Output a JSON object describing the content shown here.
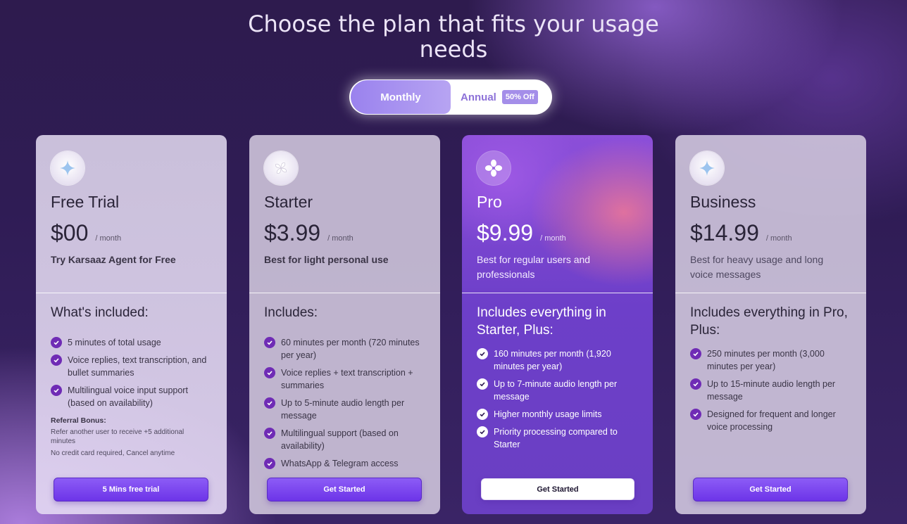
{
  "header": {
    "title": "Choose the plan that fits your usage needs"
  },
  "billing_toggle": {
    "monthly_label": "Monthly",
    "annual_label": "Annual",
    "annual_badge": "50% Off",
    "selected": "Monthly"
  },
  "plans": [
    {
      "icon": "sparkle-icon",
      "name": "Free Trial",
      "price": "$00",
      "period": "/ month",
      "description": "Try Karsaaz Agent for Free",
      "includes_title": "What's included:",
      "features": [
        "5 minutes of total usage",
        "Voice replies, text transcription, and bullet summaries",
        "Multilingual voice input support (based on availability)"
      ],
      "referral_heading": "Referral Bonus:",
      "referral_text": "Refer another user to receive +5 additional minutes",
      "note": "No credit card required, Cancel anytime",
      "button": "5 Mins free trial"
    },
    {
      "icon": "pinwheel-icon",
      "name": "Starter",
      "price": "$3.99",
      "period": "/ month",
      "description": "Best for light personal use",
      "includes_title": "Includes:",
      "features": [
        "60 minutes per month (720 minutes per year)",
        "Voice replies + text transcription + summaries",
        "Up to 5-minute audio length per message",
        "Multilingual support (based on availability)",
        "WhatsApp & Telegram access"
      ],
      "button": "Get Started"
    },
    {
      "icon": "flower-icon",
      "name": "Pro",
      "price": "$9.99",
      "period": "/ month",
      "description": "Best for regular users and professionals",
      "includes_title": "Includes everything in Starter, Plus:",
      "features": [
        "160 minutes per month (1,920 minutes per year)",
        "Up to 7-minute audio length per message",
        "Higher monthly usage limits",
        "Priority processing compared to Starter"
      ],
      "button": "Get Started"
    },
    {
      "icon": "sparkle-icon",
      "name": "Business",
      "price": "$14.99",
      "period": "/ month",
      "description": "Best for heavy usage and long voice messages",
      "includes_title": "Includes everything in Pro, Plus:",
      "features": [
        "250 minutes per month (3,000 minutes per year)",
        "Up to 15-minute audio length per message",
        "Designed for frequent and longer voice processing"
      ],
      "button": "Get Started"
    }
  ],
  "colors": {
    "accent": "#7a45ee",
    "check": "#6f2bb5",
    "toggle_active": "#9a82ee"
  }
}
